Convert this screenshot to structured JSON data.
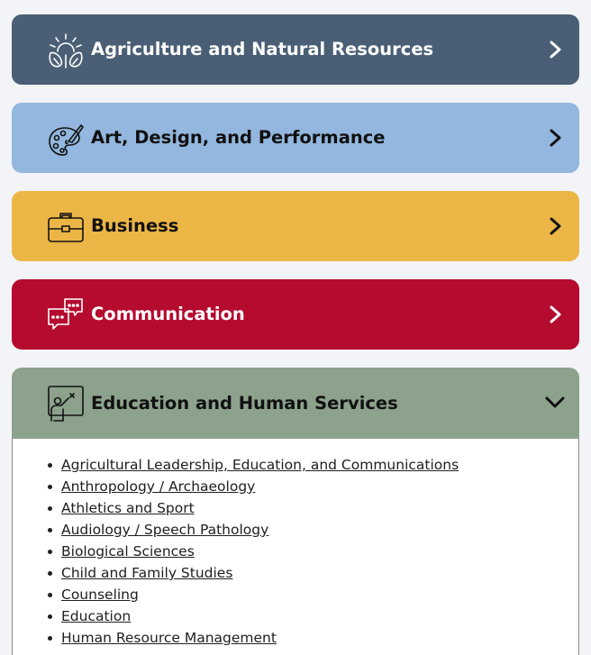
{
  "panels": [
    {
      "title": "Agriculture and Natural Resources",
      "icon": "plant-sun-icon",
      "bg": "#4a5f75",
      "fg": "#ffffff",
      "state": "collapsed"
    },
    {
      "title": "Art, Design, and Performance",
      "icon": "palette-icon",
      "bg": "#93b7de",
      "fg": "#111111",
      "state": "collapsed"
    },
    {
      "title": "Business",
      "icon": "briefcase-icon",
      "bg": "#ecb647",
      "fg": "#111111",
      "state": "collapsed"
    },
    {
      "title": "Communication",
      "icon": "chat-bubbles-icon",
      "bg": "#b50b2f",
      "fg": "#ffffff",
      "state": "collapsed"
    },
    {
      "title": "Education and Human Services",
      "icon": "teacher-board-icon",
      "bg": "#8ca28d",
      "fg": "#111111",
      "state": "expanded"
    }
  ],
  "education_links": [
    "Agricultural Leadership, Education, and Communications",
    "Anthropology / Archaeology",
    "Athletics and Sport",
    "Audiology / Speech Pathology",
    "Biological Sciences",
    "Child and Family Studies",
    "Counseling",
    "Education",
    "Human Resource Management"
  ]
}
